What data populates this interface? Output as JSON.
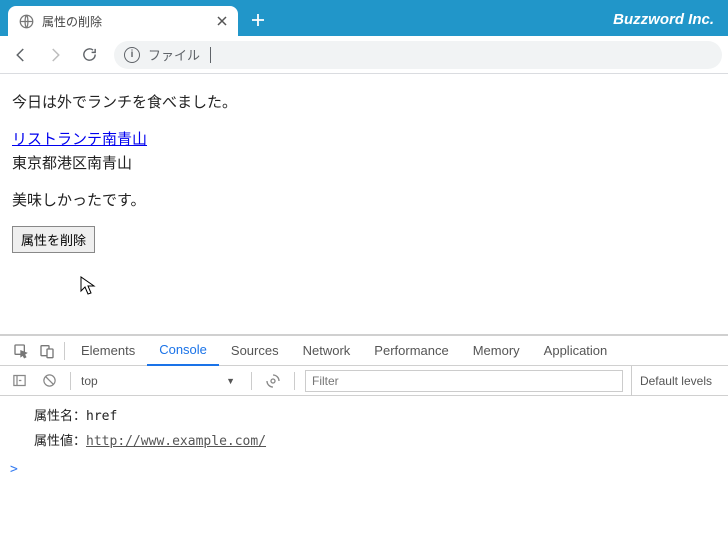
{
  "browser": {
    "brand": "Buzzword Inc.",
    "tab_title": "属性の削除",
    "address_label": "ファイル"
  },
  "page": {
    "line1": "今日は外でランチを食べました。",
    "link_text": "リストランテ南青山",
    "address": "東京都港区南青山",
    "line2": "美味しかったです。",
    "button_label": "属性を削除"
  },
  "devtools": {
    "tabs": {
      "elements": "Elements",
      "console": "Console",
      "sources": "Sources",
      "network": "Network",
      "performance": "Performance",
      "memory": "Memory",
      "application": "Application"
    },
    "context": "top",
    "filter_placeholder": "Filter",
    "levels": "Default levels",
    "console": {
      "row1_label": "属性名：",
      "row1_value": "href",
      "row2_label": "属性値：",
      "row2_link": "http://www.example.com/"
    },
    "prompt": ">"
  }
}
